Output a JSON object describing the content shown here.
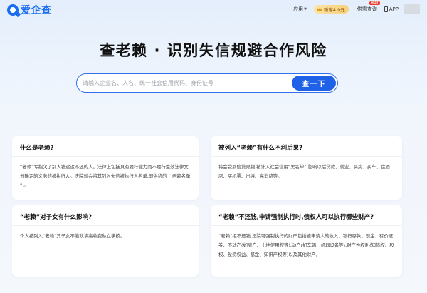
{
  "header": {
    "logo_text": "爱企查",
    "apps_label": "应用",
    "vip_label": "新客4.9元",
    "supply_label": "供需查询",
    "hot_badge": "HOT",
    "app_label": "APP"
  },
  "hero": {
    "title": "查老赖 · 识别失信规避合作风险"
  },
  "search": {
    "placeholder": "请输入企业名、人名、统一社会信用代码、身份证号",
    "button_label": "查一下"
  },
  "cards": [
    {
      "title": "什么是老赖?",
      "body": "“老赖”专指欠了别人钱迟迟不还的人。法律上包括具有履行能力而不履行生效法律文书确定的义务的被执行人。法院就会将其列入失信被执行人名单,即俗称的 “ 老赖名单 ” 。"
    },
    {
      "title": "被列入“老赖”有什么不利后果?",
      "body": "将会受到信贷限制,被计入社会信用“黑名单”,影响以后贷款、就业、买房、买车、住酒店、买机票、出境、高消费等。"
    },
    {
      "title": "“老赖”对子女有什么影响?",
      "body": "个人被列入“老赖”其子女不能就读高收费私立学校。"
    },
    {
      "title": "“老赖”不还钱,申请强制执行时,债权人可以执行哪些财产?",
      "body": "“老赖”拒不还钱,法院可强制执行的财产包括被申请人的收入、银行存款、现金、有价证券、不动产(如房产、土地使用权等),动产(如车辆、机器设备等),财产性权利(知债权、股权、投资权益、基金、知识产权等)以及其他财产。"
    }
  ]
}
